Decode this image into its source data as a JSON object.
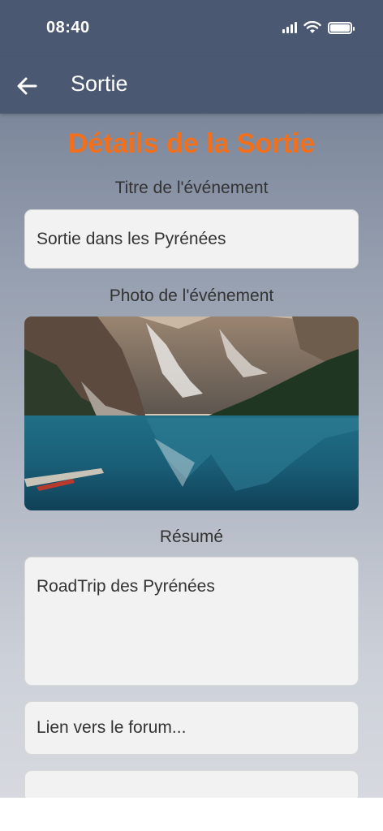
{
  "status_bar": {
    "time": "08:40",
    "icons": [
      "signal-icon",
      "wifi-icon",
      "battery-icon"
    ]
  },
  "app_bar": {
    "back_icon": "arrow-left-icon",
    "title": "Sortie"
  },
  "main": {
    "section_title": "Détails de la Sortie",
    "title_label": "Titre de l'événement",
    "title_value": "Sortie dans les Pyrénées",
    "photo_label": "Photo de l'événement",
    "summary_label": "Résumé",
    "summary_value": "RoadTrip des Pyrénées",
    "forum_placeholder": "Lien vers le forum..."
  },
  "colors": {
    "app_bar": "#4b5872",
    "accent": "#f26f1c",
    "field_bg": "#f2f2f2"
  }
}
